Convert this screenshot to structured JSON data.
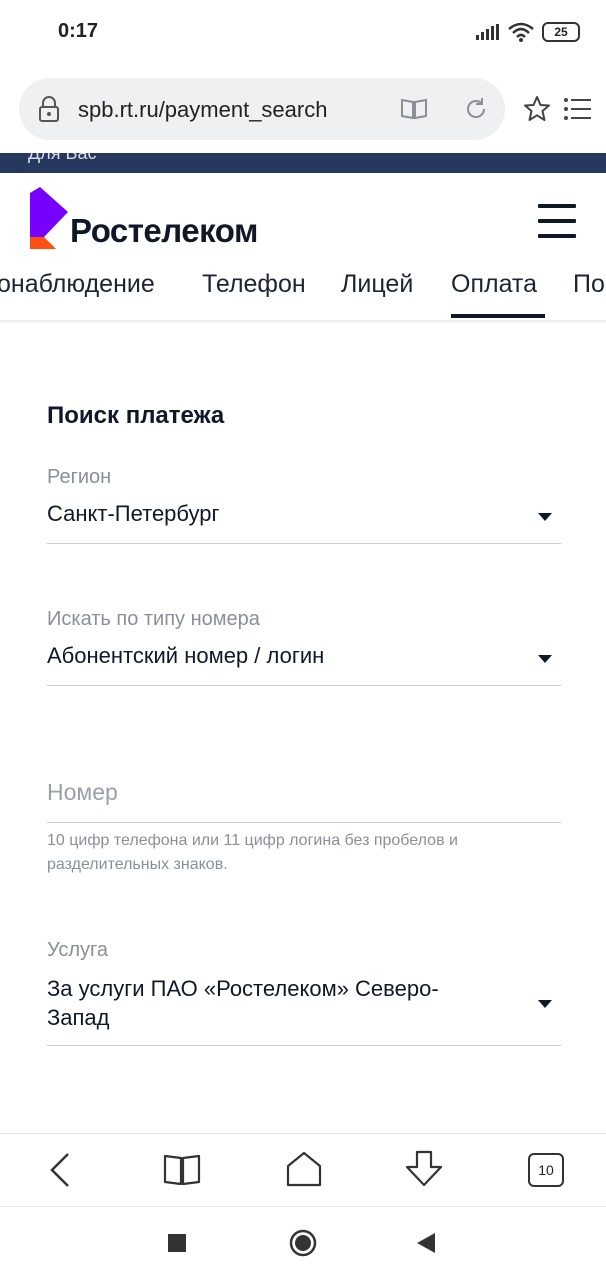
{
  "status_bar": {
    "time": "0:17",
    "battery": "25"
  },
  "browser": {
    "url": "spb.rt.ru/payment_search",
    "tabs_count": "10"
  },
  "site": {
    "strip_text": "Для Вас",
    "brand": "Ростелеком",
    "nav_tabs": [
      {
        "label": "онаблюдение"
      },
      {
        "label": "Телефон"
      },
      {
        "label": "Лицей"
      },
      {
        "label": "Оплата",
        "active": true
      },
      {
        "label": "По"
      }
    ]
  },
  "form": {
    "title": "Поиск платежа",
    "region": {
      "label": "Регион",
      "value": "Санкт-Петербург"
    },
    "search_type": {
      "label": "Искать по типу номера",
      "value": "Абонентский номер / логин"
    },
    "number": {
      "placeholder": "Номер",
      "hint": "10 цифр телефона или 11 цифр логина без пробелов и разделительных знаков."
    },
    "service": {
      "label": "Услуга",
      "value_line1": "За услуги ПАО «Ростелеком» Северо-",
      "value_line2": "Запад"
    }
  },
  "colors": {
    "brand_purple": "#7700ff",
    "brand_orange": "#ff4f12",
    "strip": "#27385f"
  }
}
